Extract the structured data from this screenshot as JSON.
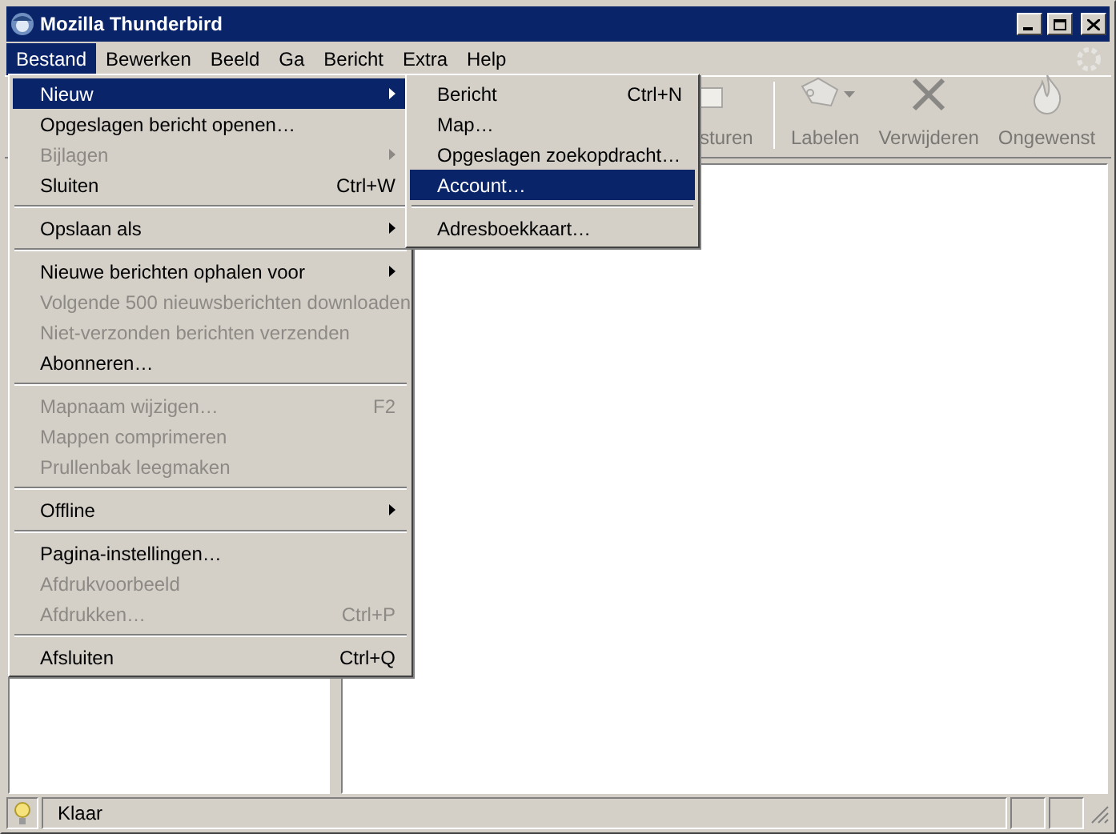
{
  "window": {
    "title": "Mozilla Thunderbird"
  },
  "menubar": [
    {
      "label": "Bestand",
      "selected": true
    },
    {
      "label": "Bewerken",
      "selected": false
    },
    {
      "label": "Beeld",
      "selected": false
    },
    {
      "label": "Ga",
      "selected": false
    },
    {
      "label": "Bericht",
      "selected": false
    },
    {
      "label": "Extra",
      "selected": false
    },
    {
      "label": "Help",
      "selected": false
    }
  ],
  "toolbar": {
    "partial_button": {
      "label": "sturen"
    },
    "buttons": [
      {
        "label": "Labelen",
        "kind": "tag",
        "dropdown": true
      },
      {
        "label": "Verwijderen",
        "kind": "delete",
        "dropdown": false
      },
      {
        "label": "Ongewenst",
        "kind": "junk",
        "dropdown": false
      }
    ]
  },
  "file_menu": [
    {
      "kind": "item",
      "label": "Nieuw",
      "submenu": true,
      "disabled": false,
      "selected": true
    },
    {
      "kind": "item",
      "label": "Opgeslagen bericht openen…",
      "submenu": false,
      "disabled": false,
      "selected": false
    },
    {
      "kind": "item",
      "label": "Bijlagen",
      "submenu": true,
      "disabled": true,
      "selected": false
    },
    {
      "kind": "item",
      "label": "Sluiten",
      "shortcut": "Ctrl+W",
      "submenu": false,
      "disabled": false,
      "selected": false
    },
    {
      "kind": "separator"
    },
    {
      "kind": "item",
      "label": "Opslaan als",
      "submenu": true,
      "disabled": false,
      "selected": false
    },
    {
      "kind": "separator"
    },
    {
      "kind": "item",
      "label": "Nieuwe berichten ophalen voor",
      "submenu": true,
      "disabled": false,
      "selected": false
    },
    {
      "kind": "item",
      "label": "Volgende 500 nieuwsberichten downloaden",
      "submenu": false,
      "disabled": true,
      "selected": false
    },
    {
      "kind": "item",
      "label": "Niet-verzonden berichten verzenden",
      "submenu": false,
      "disabled": true,
      "selected": false
    },
    {
      "kind": "item",
      "label": "Abonneren…",
      "submenu": false,
      "disabled": false,
      "selected": false
    },
    {
      "kind": "separator"
    },
    {
      "kind": "item",
      "label": "Mapnaam wijzigen…",
      "shortcut": "F2",
      "submenu": false,
      "disabled": true,
      "selected": false
    },
    {
      "kind": "item",
      "label": "Mappen comprimeren",
      "submenu": false,
      "disabled": true,
      "selected": false
    },
    {
      "kind": "item",
      "label": "Prullenbak leegmaken",
      "submenu": false,
      "disabled": true,
      "selected": false
    },
    {
      "kind": "separator"
    },
    {
      "kind": "item",
      "label": "Offline",
      "submenu": true,
      "disabled": false,
      "selected": false
    },
    {
      "kind": "separator"
    },
    {
      "kind": "item",
      "label": "Pagina-instellingen…",
      "submenu": false,
      "disabled": false,
      "selected": false
    },
    {
      "kind": "item",
      "label": "Afdrukvoorbeeld",
      "submenu": false,
      "disabled": true,
      "selected": false
    },
    {
      "kind": "item",
      "label": "Afdrukken…",
      "shortcut": "Ctrl+P",
      "submenu": false,
      "disabled": true,
      "selected": false
    },
    {
      "kind": "separator"
    },
    {
      "kind": "item",
      "label": "Afsluiten",
      "shortcut": "Ctrl+Q",
      "submenu": false,
      "disabled": false,
      "selected": false
    }
  ],
  "new_submenu": [
    {
      "kind": "item",
      "label": "Bericht",
      "shortcut": "Ctrl+N",
      "submenu": false,
      "disabled": false,
      "selected": false
    },
    {
      "kind": "item",
      "label": "Map…",
      "submenu": false,
      "disabled": false,
      "selected": false
    },
    {
      "kind": "item",
      "label": "Opgeslagen zoekopdracht…",
      "submenu": false,
      "disabled": false,
      "selected": false
    },
    {
      "kind": "item",
      "label": "Account…",
      "submenu": false,
      "disabled": false,
      "selected": true
    },
    {
      "kind": "separator"
    },
    {
      "kind": "item",
      "label": "Adresboekkaart…",
      "submenu": false,
      "disabled": false,
      "selected": false
    }
  ],
  "status_bar": {
    "text": "Klaar"
  }
}
